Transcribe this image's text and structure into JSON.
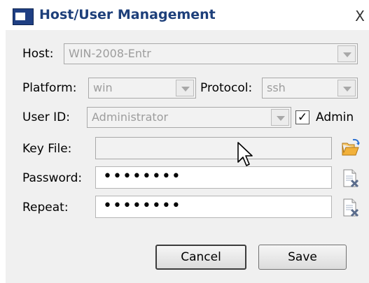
{
  "window": {
    "title": "Host/User Management",
    "close_glyph": "X"
  },
  "form": {
    "host": {
      "label": "Host:",
      "value": "WIN-2008-Entr"
    },
    "platform": {
      "label": "Platform:",
      "value": "win"
    },
    "protocol": {
      "label": "Protocol:",
      "value": "ssh"
    },
    "user_id": {
      "label": "User ID:",
      "value": "Administrator"
    },
    "admin": {
      "label": "Admin",
      "checked": true,
      "check_glyph": "✓"
    },
    "key_file": {
      "label": "Key File:",
      "value": ""
    },
    "password": {
      "label": "Password:",
      "masked": "••••••••"
    },
    "repeat": {
      "label": "Repeat:",
      "masked": "••••••••"
    }
  },
  "buttons": {
    "cancel": "Cancel",
    "save": "Save"
  },
  "icons": {
    "browse": "open-folder-icon",
    "clear_password": "clear-field-icon",
    "clear_repeat": "clear-field-icon",
    "cursor": "mouse-pointer-icon"
  }
}
